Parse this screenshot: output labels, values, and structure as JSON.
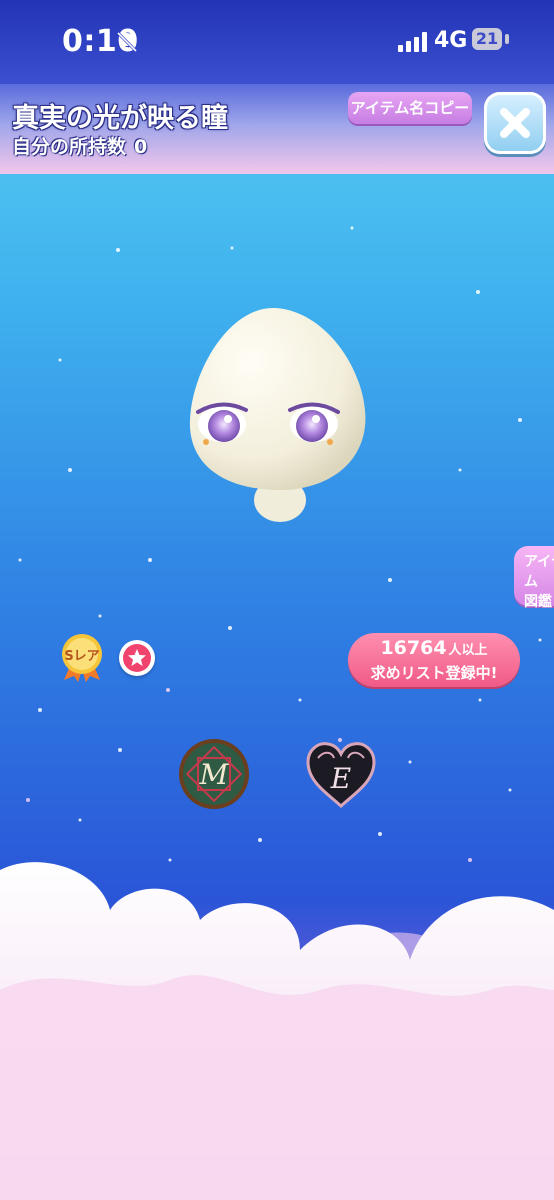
{
  "status_bar": {
    "time": "0:10",
    "network": "4G",
    "battery": "21"
  },
  "header": {
    "item_name": "真実の光が映る瞳",
    "owned_label": "自分の所持数",
    "owned_count": "0",
    "copy_button_label": "アイテム名コピー"
  },
  "catalog_button": {
    "line1": "アイテム",
    "line2": "図鑑"
  },
  "rarity": {
    "label": "Sレア"
  },
  "wishlist": {
    "count": "16764",
    "count_unit": "人以上",
    "label": "求めリスト登録中!"
  },
  "brand_badges": {
    "badge1_letter": "M",
    "badge2_letter": "E"
  },
  "colors": {
    "accent_pink": "#f05a86",
    "copy_button": "#c67ee2",
    "header_top": "#2334b6"
  },
  "icons": {
    "status": [
      "bell-muted-icon",
      "signal-icon"
    ],
    "close": "close-icon",
    "favorite": "star-icon"
  }
}
